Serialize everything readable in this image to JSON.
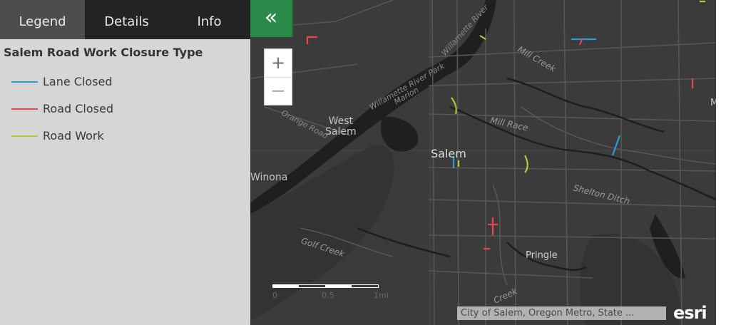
{
  "tabs": [
    {
      "label": "Legend",
      "active": true
    },
    {
      "label": "Details",
      "active": false
    },
    {
      "label": "Info",
      "active": false
    }
  ],
  "legend": {
    "title": "Salem Road Work Closure Type",
    "items": [
      {
        "label": "Lane Closed",
        "color": "#2b9bd6"
      },
      {
        "label": "Road Closed",
        "color": "#e8434e"
      },
      {
        "label": "Road Work",
        "color": "#a6cf3a"
      }
    ]
  },
  "map": {
    "collapse_icon": "double-chevron-left-icon",
    "collapse_glyph": "«",
    "zoom_in": "+",
    "zoom_out": "—",
    "labels": {
      "west_salem": "West\nSalem",
      "salem": "Salem",
      "winona": "Winona",
      "mill_race": "Mill Race",
      "mill_creek": "Mill Creek",
      "shelton_ditch": "Shelton Ditch",
      "golf_creek": "Golf Creek",
      "pringle": "Pringle",
      "willamette_top": "Willamette River",
      "willamette_mid": "Willamette River Park",
      "marion": "Marion",
      "edge_m": "M",
      "creek_bottom": "Creek",
      "orange_road": "Orange Road"
    },
    "scalebar": {
      "labels": [
        "0",
        "0.5",
        "1mi"
      ]
    },
    "attribution": "City of Salem, Oregon Metro, State ...",
    "logo": "esri",
    "colors": {
      "background": "#3b3b3b",
      "roads": "#575757",
      "water": "#1f1f1f",
      "accent": "#2a8a4a"
    }
  }
}
